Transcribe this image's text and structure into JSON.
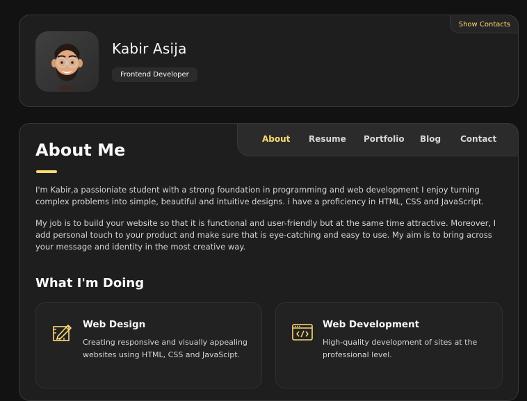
{
  "profile": {
    "name": "Kabir Asija",
    "role": "Frontend Developer",
    "show_contacts_label": "Show Contacts"
  },
  "nav": {
    "items": [
      {
        "label": "About",
        "active": true
      },
      {
        "label": "Resume",
        "active": false
      },
      {
        "label": "Portfolio",
        "active": false
      },
      {
        "label": "Blog",
        "active": false
      },
      {
        "label": "Contact",
        "active": false
      }
    ]
  },
  "about": {
    "title": "About Me",
    "paragraphs": [
      "I'm Kabir,a passioniate student with a strong foundation in programming and web development I enjoy turning complex problems into simple, beautiful and intuitive designs. i have a proficiency in HTML, CSS and JavaScript.",
      "My job is to build your website so that it is functional and user-friendly but at the same time attractive. Moreover, I add personal touch to your product and make sure that is eye-catching and easy to use. My aim is to bring across your message and identity in the most creative way."
    ]
  },
  "doing": {
    "title": "What I'm Doing",
    "services": [
      {
        "title": "Web Design",
        "text": "Creating responsive and visually appealing websites using HTML, CSS and JavaScipt.",
        "icon": "design-icon"
      },
      {
        "title": "Web Development",
        "text": "High-quality development of sites at the professional level.",
        "icon": "code-icon"
      }
    ]
  },
  "colors": {
    "accent": "#ffdb70",
    "background": "#121212",
    "card": "#1e1e1f"
  }
}
